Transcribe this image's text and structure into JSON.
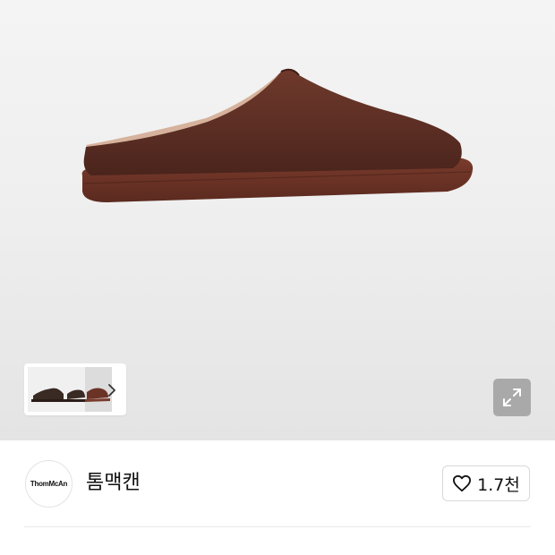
{
  "product": {
    "image_label": "brown suede mule",
    "colors": {
      "suede": "#5e2f25",
      "sole": "#6b3326",
      "lining": "#d8b7a3",
      "background": "#efefef"
    }
  },
  "gallery": {
    "thumbnail_label": "product thumbnail",
    "next_icon": "chevron-right-icon",
    "expand_icon": "expand-icon"
  },
  "brand": {
    "logo_text": "ThomMcAn",
    "name": "톰맥캔"
  },
  "like": {
    "icon": "heart-icon",
    "count": "1.7천"
  }
}
